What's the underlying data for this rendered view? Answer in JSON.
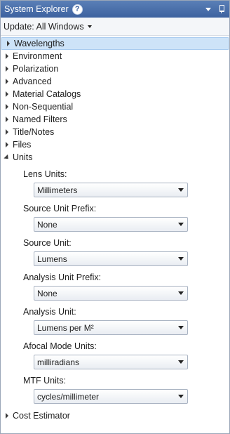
{
  "window": {
    "title": "System Explorer",
    "help_icon_glyph": "?"
  },
  "update_bar": {
    "label": "Update: All Windows"
  },
  "tree": {
    "items": [
      {
        "label": "Wavelengths",
        "selected": true
      },
      {
        "label": "Environment"
      },
      {
        "label": "Polarization"
      },
      {
        "label": "Advanced"
      },
      {
        "label": "Material Catalogs"
      },
      {
        "label": "Non-Sequential"
      },
      {
        "label": "Named Filters"
      },
      {
        "label": "Title/Notes"
      },
      {
        "label": "Files"
      },
      {
        "label": "Units",
        "expanded": true
      }
    ],
    "units_fields": [
      {
        "label": "Lens Units:",
        "value": "Millimeters"
      },
      {
        "label": "Source Unit Prefix:",
        "value": "None"
      },
      {
        "label": "Source Unit:",
        "value": "Lumens"
      },
      {
        "label": "Analysis Unit Prefix:",
        "value": "None"
      },
      {
        "label": "Analysis Unit:",
        "value": "Lumens per M²"
      },
      {
        "label": "Afocal Mode Units:",
        "value": "milliradians"
      },
      {
        "label": "MTF Units:",
        "value": "cycles/millimeter"
      }
    ],
    "last_item": {
      "label": "Cost Estimator"
    }
  },
  "icons": {
    "help": "help-icon",
    "window_menu": "chevron-down-icon",
    "pin": "pin-icon",
    "collapsed": "chevron-right-icon",
    "expanded": "chevron-down-icon"
  },
  "colors": {
    "titlebar": "#3d62a0",
    "selection": "#cde3f8"
  }
}
